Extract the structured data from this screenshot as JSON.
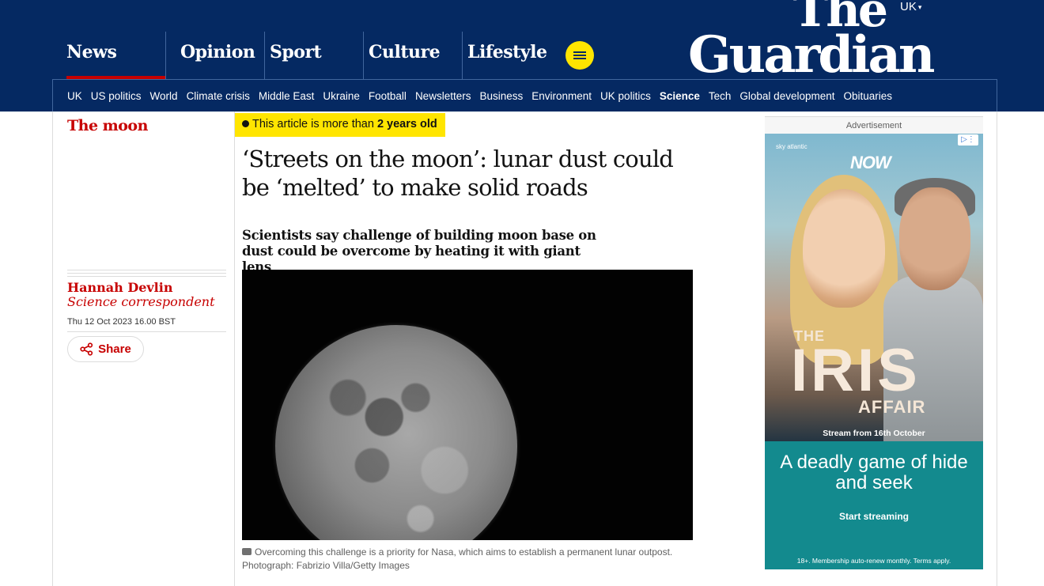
{
  "header": {
    "edition": "UK",
    "logo_line1": "The",
    "logo_line2": "Guardian",
    "pillars": [
      "News",
      "Opinion",
      "Sport",
      "Culture",
      "Lifestyle"
    ],
    "active_pillar": "News",
    "subnav": [
      "UK",
      "US politics",
      "World",
      "Climate crisis",
      "Middle East",
      "Ukraine",
      "Football",
      "Newsletters",
      "Business",
      "Environment",
      "UK politics",
      "Science",
      "Tech",
      "Global development",
      "Obituaries"
    ],
    "current_subnav": "Science"
  },
  "article": {
    "section": "The moon",
    "age_notice_prefix": "This article is more than",
    "age_notice_value": "2 years old",
    "headline": "‘Streets on the moon’: lunar dust could be ‘melted’ to make solid roads",
    "standfirst": "Scientists say challenge of building moon base on dust could be overcome by heating it with giant lens",
    "author": "Hannah Devlin",
    "author_role": "Science correspondent",
    "date": "Thu 12 Oct 2023 16.00 BST",
    "share_label": "Share",
    "caption": "Overcoming this challenge is a priority for Nasa, which aims to establish a permanent lunar outpost. Photograph: Fabrizio Villa/Getty Images"
  },
  "ad": {
    "label": "Advertisement",
    "brand": "NOW",
    "channel": "sky atlantic",
    "title_the": "THE",
    "title_main": "IRIS",
    "title_sub": "AFFAIR",
    "stream_date": "Stream from 16th October",
    "tagline": "A deadly game of hide and seek",
    "cta": "Start streaming",
    "terms": "18+. Membership auto-renew monthly. Terms apply."
  },
  "colors": {
    "brand_blue": "#052962",
    "news_red": "#c70000",
    "highlight_yellow": "#ffe500",
    "ad_teal": "#138a8e"
  }
}
